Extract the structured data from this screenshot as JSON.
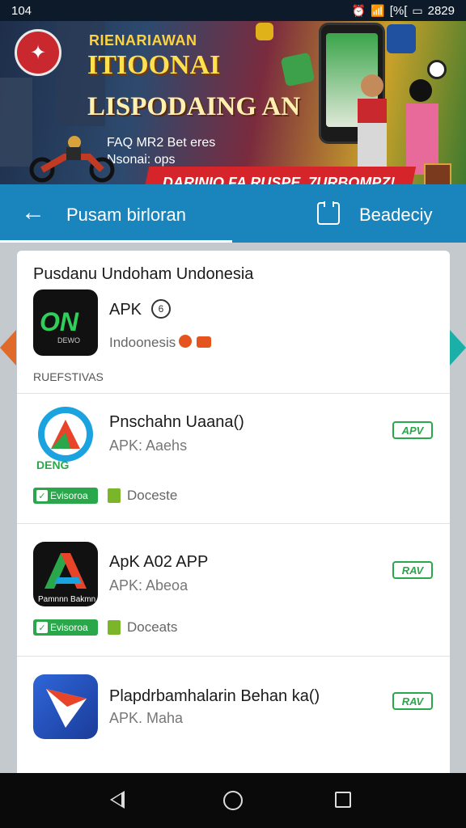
{
  "status_bar": {
    "time": "104",
    "battery": "[%[",
    "clock": "2829"
  },
  "banner": {
    "line1": "RIENARIAWAN",
    "line2": "ITIOONAI",
    "line3": "LISPODAING AN",
    "line4": "FAQ MR2 Bet eres",
    "line5": "Nsonai: ops",
    "ribbon": "DARINIQ FA RUSPE. 7URBOMPZ!"
  },
  "app_bar": {
    "title": "Pusam birloran",
    "action": "Beadeciy"
  },
  "card": {
    "title": "Pusdanu Undoham Undonesia",
    "featured": {
      "name": "APK",
      "badge": "6",
      "subtitle": "Indoonesis",
      "icon_text": "ON",
      "icon_sub": "DEWO"
    },
    "section_label": "RUEFSTIVAS",
    "items": [
      {
        "name": "Pnschahn Uaana()",
        "sub": "APK: Aaehs",
        "tag": "APV",
        "verified": "Evisoroa",
        "location": "Doceste",
        "icon_caption": "DENG"
      },
      {
        "name": "ApK A02 APP",
        "sub": "APK: Abeoa",
        "tag": "RAV",
        "verified": "Evisoroa",
        "location": "Doceats",
        "icon_caption": "Pamnnn Bakmn"
      },
      {
        "name": "Plapdrbamhalarin Behan ka()",
        "sub": "APK. Maha",
        "tag": "RAV"
      }
    ]
  },
  "colors": {
    "accent": "#1a84bd",
    "tag_green": "#2aa74a",
    "banner_red": "#d6252a"
  }
}
